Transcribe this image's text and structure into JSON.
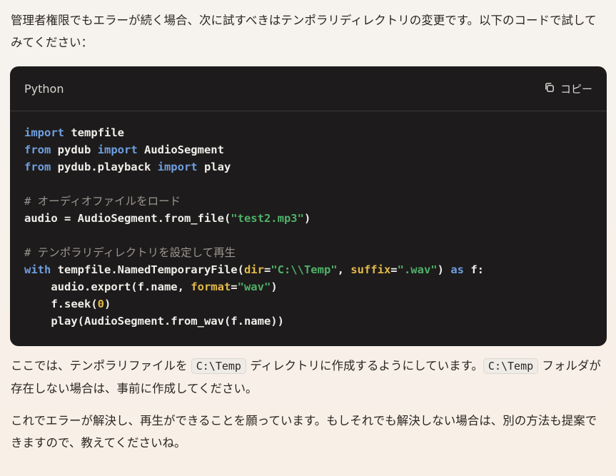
{
  "message": {
    "intro": "管理者権限でもエラーが続く場合、次に試すべきはテンポラリディレクトリの変更です。以下のコードで試してみてください：",
    "code_block": {
      "language": "Python",
      "copy_label": "コピー",
      "lines": [
        [
          {
            "t": "import",
            "c": "kw"
          },
          {
            "t": " tempfile",
            "c": ""
          }
        ],
        [
          {
            "t": "from",
            "c": "kw"
          },
          {
            "t": " pydub ",
            "c": ""
          },
          {
            "t": "import",
            "c": "kw"
          },
          {
            "t": " AudioSegment",
            "c": ""
          }
        ],
        [
          {
            "t": "from",
            "c": "kw"
          },
          {
            "t": " pydub.playback ",
            "c": ""
          },
          {
            "t": "import",
            "c": "kw"
          },
          {
            "t": " play",
            "c": ""
          }
        ],
        [],
        [
          {
            "t": "# オーディオファイルをロード",
            "c": "cmt"
          }
        ],
        [
          {
            "t": "audio = AudioSegment.from_file(",
            "c": ""
          },
          {
            "t": "\"test2.mp3\"",
            "c": "str"
          },
          {
            "t": ")",
            "c": ""
          }
        ],
        [],
        [
          {
            "t": "# テンポラリディレクトリを設定して再生",
            "c": "cmt"
          }
        ],
        [
          {
            "t": "with",
            "c": "kw"
          },
          {
            "t": " tempfile.NamedTemporaryFile(",
            "c": ""
          },
          {
            "t": "dir",
            "c": "kwarg"
          },
          {
            "t": "=",
            "c": ""
          },
          {
            "t": "\"C:\\\\Temp\"",
            "c": "str"
          },
          {
            "t": ", ",
            "c": ""
          },
          {
            "t": "suffix",
            "c": "kwarg"
          },
          {
            "t": "=",
            "c": ""
          },
          {
            "t": "\".wav\"",
            "c": "str"
          },
          {
            "t": ") ",
            "c": ""
          },
          {
            "t": "as",
            "c": "kw"
          },
          {
            "t": " f:",
            "c": ""
          }
        ],
        [
          {
            "t": "    audio.export(f.name, ",
            "c": ""
          },
          {
            "t": "format",
            "c": "kwarg"
          },
          {
            "t": "=",
            "c": ""
          },
          {
            "t": "\"wav\"",
            "c": "str"
          },
          {
            "t": ")",
            "c": ""
          }
        ],
        [
          {
            "t": "    f.seek(",
            "c": ""
          },
          {
            "t": "0",
            "c": "num"
          },
          {
            "t": ")",
            "c": ""
          }
        ],
        [
          {
            "t": "    play(AudioSegment.from_wav(f.name))",
            "c": ""
          }
        ]
      ]
    },
    "explanation": {
      "part1": "ここでは、テンポラリファイルを ",
      "code1": "C:\\Temp",
      "part2": " ディレクトリに作成するようにしています。",
      "code2": "C:\\Temp",
      "part3": " フォルダが存在しない場合は、事前に作成してください。"
    },
    "closing": "これでエラーが解決し、再生ができることを願っています。もしそれでも解決しない場合は、別の方法も提案できますので、教えてくださいね。"
  }
}
